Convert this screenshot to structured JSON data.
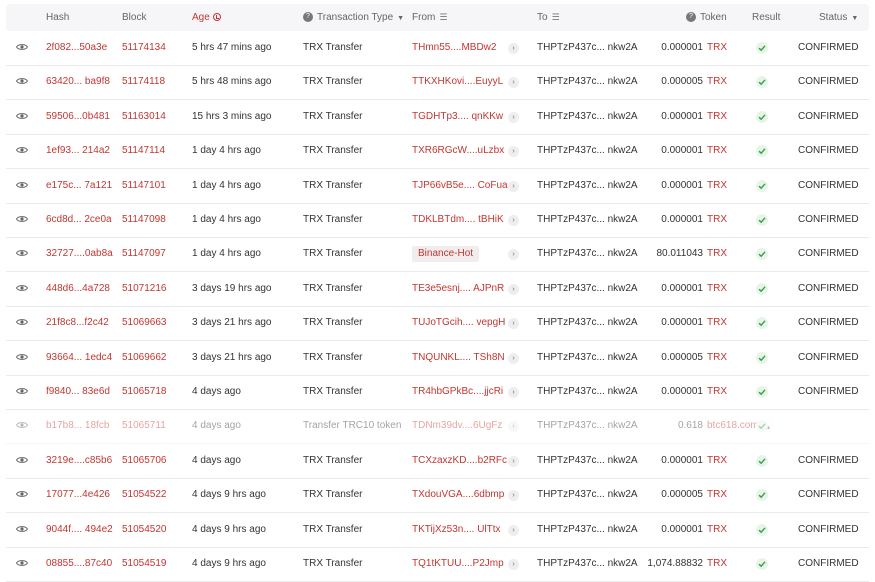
{
  "header": {
    "hash": "Hash",
    "block": "Block",
    "age": "Age",
    "transaction_type": "Transaction Type",
    "from": "From",
    "to": "To",
    "token": "Token",
    "result": "Result",
    "status": "Status"
  },
  "rows": [
    {
      "hash": "2f082...50a3e",
      "block": "51174134",
      "age": "5 hrs 47 mins ago",
      "type": "TRX Transfer",
      "from": "THmn55....MBDw2",
      "from_tag": false,
      "to": "THPTzP437c... nkw2A",
      "amount": "0.000001",
      "token": "TRX",
      "status": "CONFIRMED",
      "dim": false
    },
    {
      "hash": "63420... ba9f8",
      "block": "51174118",
      "age": "5 hrs 48 mins ago",
      "type": "TRX Transfer",
      "from": "TTKXHKovi....EuyyL",
      "from_tag": false,
      "to": "THPTzP437c... nkw2A",
      "amount": "0.000005",
      "token": "TRX",
      "status": "CONFIRMED",
      "dim": false
    },
    {
      "hash": "59506...0b481",
      "block": "51163014",
      "age": "15 hrs 3 mins ago",
      "type": "TRX Transfer",
      "from": "TGDHTp3.... qnKKw",
      "from_tag": false,
      "to": "THPTzP437c... nkw2A",
      "amount": "0.000001",
      "token": "TRX",
      "status": "CONFIRMED",
      "dim": false
    },
    {
      "hash": "1ef93... 214a2",
      "block": "51147114",
      "age": "1 day 4 hrs ago",
      "type": "TRX Transfer",
      "from": "TXR6RGcW....uLzbx",
      "from_tag": false,
      "to": "THPTzP437c... nkw2A",
      "amount": "0.000001",
      "token": "TRX",
      "status": "CONFIRMED",
      "dim": false
    },
    {
      "hash": "e175c... 7a121",
      "block": "51147101",
      "age": "1 day 4 hrs ago",
      "type": "TRX Transfer",
      "from": "TJP66vB5e.... CoFua",
      "from_tag": false,
      "to": "THPTzP437c... nkw2A",
      "amount": "0.000001",
      "token": "TRX",
      "status": "CONFIRMED",
      "dim": false
    },
    {
      "hash": "6cd8d... 2ce0a",
      "block": "51147098",
      "age": "1 day 4 hrs ago",
      "type": "TRX Transfer",
      "from": "TDKLBTdm.... tBHiK",
      "from_tag": false,
      "to": "THPTzP437c... nkw2A",
      "amount": "0.000001",
      "token": "TRX",
      "status": "CONFIRMED",
      "dim": false
    },
    {
      "hash": "32727....0ab8a",
      "block": "51147097",
      "age": "1 day 4 hrs ago",
      "type": "TRX Transfer",
      "from": "Binance-Hot",
      "from_tag": true,
      "to": "THPTzP437c... nkw2A",
      "amount": "80.011043",
      "token": "TRX",
      "status": "CONFIRMED",
      "dim": false
    },
    {
      "hash": "448d6...4a728",
      "block": "51071216",
      "age": "3 days 19 hrs ago",
      "type": "TRX Transfer",
      "from": "TE3e5esnj.... AJPnR",
      "from_tag": false,
      "to": "THPTzP437c... nkw2A",
      "amount": "0.000001",
      "token": "TRX",
      "status": "CONFIRMED",
      "dim": false
    },
    {
      "hash": "21f8c8...f2c42",
      "block": "51069663",
      "age": "3 days 21 hrs ago",
      "type": "TRX Transfer",
      "from": "TUJoTGcih.... vepgH",
      "from_tag": false,
      "to": "THPTzP437c... nkw2A",
      "amount": "0.000001",
      "token": "TRX",
      "status": "CONFIRMED",
      "dim": false
    },
    {
      "hash": "93664... 1edc4",
      "block": "51069662",
      "age": "3 days 21 hrs ago",
      "type": "TRX Transfer",
      "from": "TNQUNKL.... TSh8N",
      "from_tag": false,
      "to": "THPTzP437c... nkw2A",
      "amount": "0.000005",
      "token": "TRX",
      "status": "CONFIRMED",
      "dim": false
    },
    {
      "hash": "f9840... 83e6d",
      "block": "51065718",
      "age": "4 days ago",
      "type": "TRX Transfer",
      "from": "TR4hbGPkBc....jjcRi",
      "from_tag": false,
      "to": "THPTzP437c... nkw2A",
      "amount": "0.000001",
      "token": "TRX",
      "status": "CONFIRMED",
      "dim": false
    },
    {
      "hash": "b17b8... 18fcb",
      "block": "51065711",
      "age": "4 days ago",
      "type": "Transfer TRC10 token",
      "from": "TDNm39dv....6UgFz",
      "from_tag": false,
      "to": "THPTzP437c... nkw2A",
      "amount": "0.618",
      "token": "btc618.com",
      "status": "",
      "dim": true
    },
    {
      "hash": "3219e....c85b6",
      "block": "51065706",
      "age": "4 days ago",
      "type": "TRX Transfer",
      "from": "TCXzaxzKD....b2RFc",
      "from_tag": false,
      "to": "THPTzP437c... nkw2A",
      "amount": "0.000001",
      "token": "TRX",
      "status": "CONFIRMED",
      "dim": false
    },
    {
      "hash": "17077...4e426",
      "block": "51054522",
      "age": "4 days 9 hrs ago",
      "type": "TRX Transfer",
      "from": "TXdouVGA....6dbmp",
      "from_tag": false,
      "to": "THPTzP437c... nkw2A",
      "amount": "0.000005",
      "token": "TRX",
      "status": "CONFIRMED",
      "dim": false
    },
    {
      "hash": "9044f.... 494e2",
      "block": "51054520",
      "age": "4 days 9 hrs ago",
      "type": "TRX Transfer",
      "from": "TKTijXz53n.... UlTtx",
      "from_tag": false,
      "to": "THPTzP437c... nkw2A",
      "amount": "0.000001",
      "token": "TRX",
      "status": "CONFIRMED",
      "dim": false
    },
    {
      "hash": "08855....87c40",
      "block": "51054519",
      "age": "4 days 9 hrs ago",
      "type": "TRX Transfer",
      "from": "TQ1tKTUU....P2Jmp",
      "from_tag": false,
      "to": "THPTzP437c... nkw2A",
      "amount": "1,074.88832",
      "token": "TRX",
      "status": "CONFIRMED",
      "dim": false
    }
  ]
}
